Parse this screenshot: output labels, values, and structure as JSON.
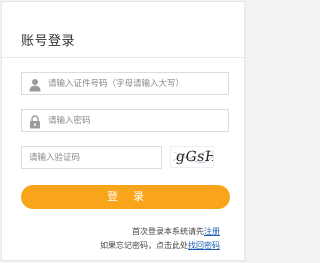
{
  "title": "账号登录",
  "fields": {
    "id_number_placeholder": "请输入证件号码（字母请输入大写）",
    "password_placeholder": "请输入密码",
    "captcha_placeholder": "请输入验证码",
    "captcha_text": "gGsH"
  },
  "login_button_label": "登 录",
  "footer": {
    "register_prefix": "首次登录本系统请先",
    "register_link": "注册",
    "forgot_prefix": "如果忘记密码，点击此处",
    "forgot_link": "找回密码"
  },
  "colors": {
    "accent": "#f9a51b",
    "link": "#1a5db0"
  },
  "icons": {
    "id_field": "user-icon",
    "password_field": "lock-icon"
  }
}
